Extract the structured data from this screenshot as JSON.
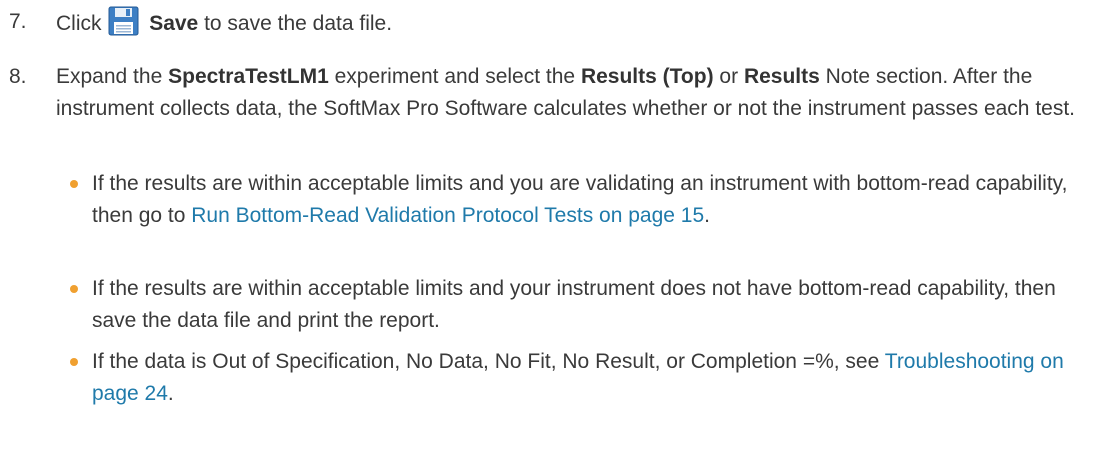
{
  "step7": {
    "number": "7.",
    "prefix": "Click",
    "icon": "save-floppy-icon",
    "bold": "Save",
    "suffix": "to save the data file."
  },
  "step8": {
    "number": "8.",
    "t1": "Expand the",
    "b1": "SpectraTestLM1",
    "t2": "experiment and select the",
    "b2": "Results (Top)",
    "t3": "or",
    "b3": "Results",
    "t4": "Note section. After the instrument collects data, the SoftMax Pro Software calculates whether or not the instrument passes each test."
  },
  "bullets": [
    {
      "text": "If the results are within acceptable limits and you are validating an instrument with bottom-read capability, then go to",
      "link": "Run Bottom-Read Validation Protocol Tests on page 15",
      "after": "."
    },
    {
      "text": "If the results are within acceptable limits and your instrument does not have bottom-read capability, then save the data file and print the report.",
      "link": "",
      "after": ""
    },
    {
      "text": "If the data is Out of Specification, No Data, No Fit, No Result, or Completion =%, see",
      "link": "Troubleshooting on page 24",
      "after": "."
    }
  ],
  "colors": {
    "text": "#3a3a3a",
    "link": "#1f7aaa",
    "bullet": "#f0a030"
  }
}
